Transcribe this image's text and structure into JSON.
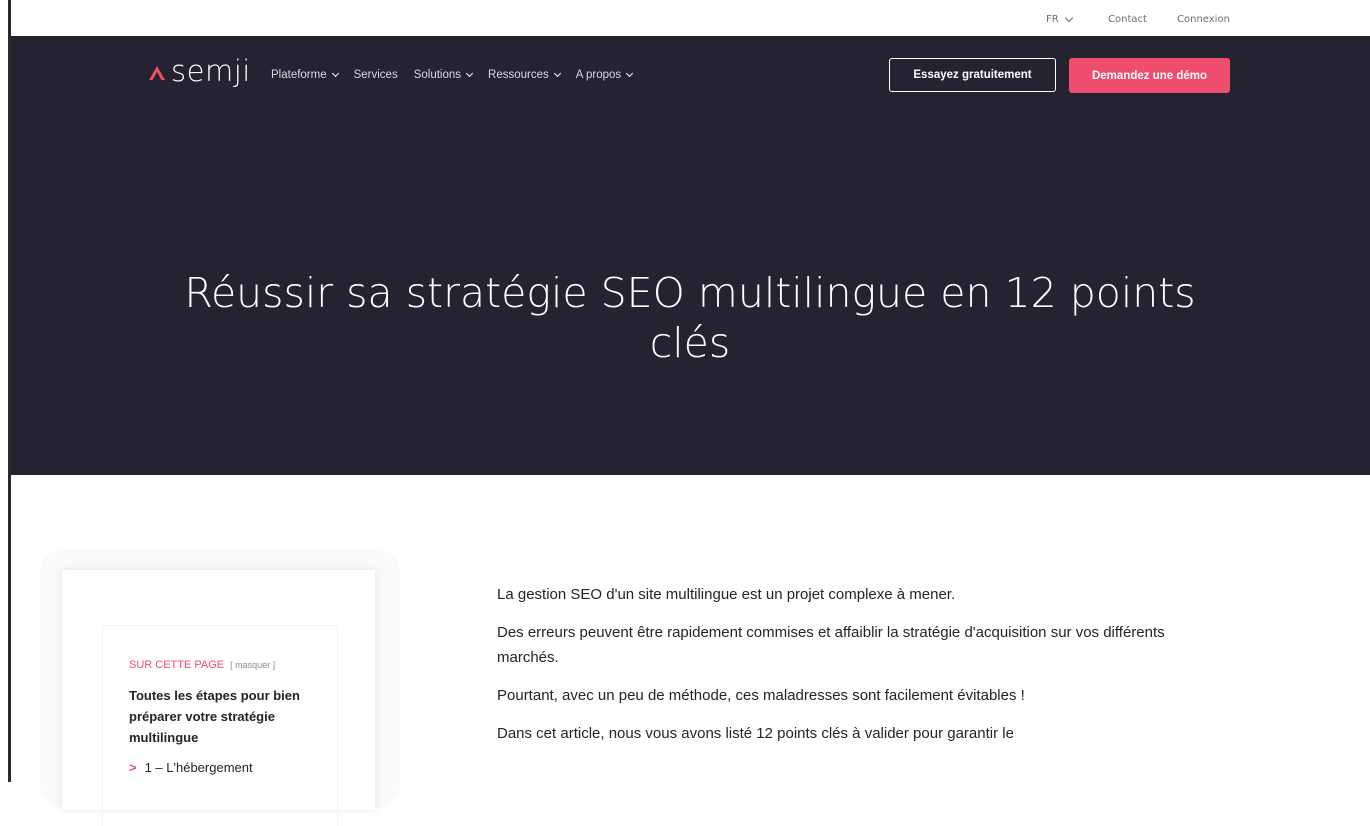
{
  "utility": {
    "lang": "FR",
    "contact": "Contact",
    "login": "Connexion"
  },
  "brand": {
    "logo_text": "semji",
    "accent": "#ee4d6e",
    "dark_bg": "#25232f"
  },
  "nav": {
    "items": [
      {
        "label": "Plateforme",
        "dropdown": true
      },
      {
        "label": "Services",
        "dropdown": false
      },
      {
        "label": "Solutions",
        "dropdown": true
      },
      {
        "label": "Ressources",
        "dropdown": true
      },
      {
        "label": "A propos",
        "dropdown": true
      }
    ],
    "trial_label": "Essayez gratuitement",
    "demo_label": "Demandez une démo"
  },
  "hero": {
    "title": "Réussir sa stratégie SEO multilingue en 12 points clés"
  },
  "toc": {
    "heading": "SUR CETTE PAGE",
    "hide_label": "[ masquer ]",
    "title": "Toutes les étapes pour bien préparer votre stratégie multilingue",
    "first_link_arrow": ">",
    "first_link": "1 – L'hébergement"
  },
  "article": {
    "paragraphs": [
      "La gestion SEO d'un site multilingue est un projet complexe à mener.",
      "Des erreurs peuvent être rapidement commises et affaiblir la stratégie d'acquisition sur vos différents marchés.",
      "Pourtant, avec un peu de méthode, ces maladresses sont facilement évitables !",
      "Dans cet article, nous vous avons listé 12 points clés à valider pour garantir le"
    ]
  }
}
